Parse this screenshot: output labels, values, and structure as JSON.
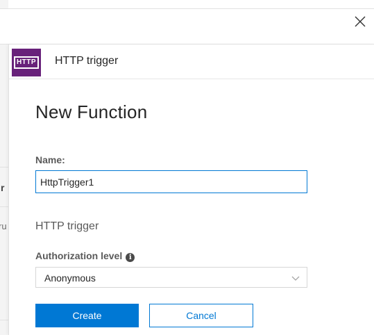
{
  "background_page": {
    "clipped_letters": [
      "r",
      "ru"
    ]
  },
  "header": {
    "close_icon": "close-icon"
  },
  "trigger": {
    "icon_text": "HTTP",
    "title": "HTTP trigger",
    "icon_color": "#68217a"
  },
  "form": {
    "title": "New Function",
    "name_label": "Name:",
    "name_value": "HttpTrigger1",
    "section_title": "HTTP trigger",
    "auth_label": "Authorization level",
    "auth_info_icon": "info-icon",
    "auth_selected": "Anonymous",
    "create_label": "Create",
    "cancel_label": "Cancel",
    "accent_color": "#0078d4"
  }
}
